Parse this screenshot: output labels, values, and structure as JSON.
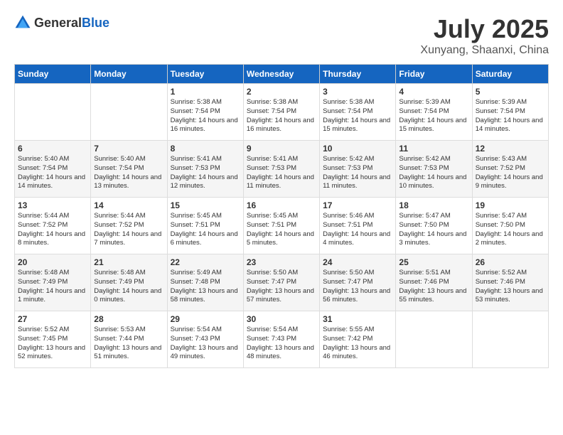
{
  "header": {
    "logo_general": "General",
    "logo_blue": "Blue",
    "month": "July 2025",
    "location": "Xunyang, Shaanxi, China"
  },
  "columns": [
    "Sunday",
    "Monday",
    "Tuesday",
    "Wednesday",
    "Thursday",
    "Friday",
    "Saturday"
  ],
  "weeks": [
    [
      {
        "day": "",
        "info": ""
      },
      {
        "day": "",
        "info": ""
      },
      {
        "day": "1",
        "info": "Sunrise: 5:38 AM\nSunset: 7:54 PM\nDaylight: 14 hours and 16 minutes."
      },
      {
        "day": "2",
        "info": "Sunrise: 5:38 AM\nSunset: 7:54 PM\nDaylight: 14 hours and 16 minutes."
      },
      {
        "day": "3",
        "info": "Sunrise: 5:38 AM\nSunset: 7:54 PM\nDaylight: 14 hours and 15 minutes."
      },
      {
        "day": "4",
        "info": "Sunrise: 5:39 AM\nSunset: 7:54 PM\nDaylight: 14 hours and 15 minutes."
      },
      {
        "day": "5",
        "info": "Sunrise: 5:39 AM\nSunset: 7:54 PM\nDaylight: 14 hours and 14 minutes."
      }
    ],
    [
      {
        "day": "6",
        "info": "Sunrise: 5:40 AM\nSunset: 7:54 PM\nDaylight: 14 hours and 14 minutes."
      },
      {
        "day": "7",
        "info": "Sunrise: 5:40 AM\nSunset: 7:54 PM\nDaylight: 14 hours and 13 minutes."
      },
      {
        "day": "8",
        "info": "Sunrise: 5:41 AM\nSunset: 7:53 PM\nDaylight: 14 hours and 12 minutes."
      },
      {
        "day": "9",
        "info": "Sunrise: 5:41 AM\nSunset: 7:53 PM\nDaylight: 14 hours and 11 minutes."
      },
      {
        "day": "10",
        "info": "Sunrise: 5:42 AM\nSunset: 7:53 PM\nDaylight: 14 hours and 11 minutes."
      },
      {
        "day": "11",
        "info": "Sunrise: 5:42 AM\nSunset: 7:53 PM\nDaylight: 14 hours and 10 minutes."
      },
      {
        "day": "12",
        "info": "Sunrise: 5:43 AM\nSunset: 7:52 PM\nDaylight: 14 hours and 9 minutes."
      }
    ],
    [
      {
        "day": "13",
        "info": "Sunrise: 5:44 AM\nSunset: 7:52 PM\nDaylight: 14 hours and 8 minutes."
      },
      {
        "day": "14",
        "info": "Sunrise: 5:44 AM\nSunset: 7:52 PM\nDaylight: 14 hours and 7 minutes."
      },
      {
        "day": "15",
        "info": "Sunrise: 5:45 AM\nSunset: 7:51 PM\nDaylight: 14 hours and 6 minutes."
      },
      {
        "day": "16",
        "info": "Sunrise: 5:45 AM\nSunset: 7:51 PM\nDaylight: 14 hours and 5 minutes."
      },
      {
        "day": "17",
        "info": "Sunrise: 5:46 AM\nSunset: 7:51 PM\nDaylight: 14 hours and 4 minutes."
      },
      {
        "day": "18",
        "info": "Sunrise: 5:47 AM\nSunset: 7:50 PM\nDaylight: 14 hours and 3 minutes."
      },
      {
        "day": "19",
        "info": "Sunrise: 5:47 AM\nSunset: 7:50 PM\nDaylight: 14 hours and 2 minutes."
      }
    ],
    [
      {
        "day": "20",
        "info": "Sunrise: 5:48 AM\nSunset: 7:49 PM\nDaylight: 14 hours and 1 minute."
      },
      {
        "day": "21",
        "info": "Sunrise: 5:48 AM\nSunset: 7:49 PM\nDaylight: 14 hours and 0 minutes."
      },
      {
        "day": "22",
        "info": "Sunrise: 5:49 AM\nSunset: 7:48 PM\nDaylight: 13 hours and 58 minutes."
      },
      {
        "day": "23",
        "info": "Sunrise: 5:50 AM\nSunset: 7:47 PM\nDaylight: 13 hours and 57 minutes."
      },
      {
        "day": "24",
        "info": "Sunrise: 5:50 AM\nSunset: 7:47 PM\nDaylight: 13 hours and 56 minutes."
      },
      {
        "day": "25",
        "info": "Sunrise: 5:51 AM\nSunset: 7:46 PM\nDaylight: 13 hours and 55 minutes."
      },
      {
        "day": "26",
        "info": "Sunrise: 5:52 AM\nSunset: 7:46 PM\nDaylight: 13 hours and 53 minutes."
      }
    ],
    [
      {
        "day": "27",
        "info": "Sunrise: 5:52 AM\nSunset: 7:45 PM\nDaylight: 13 hours and 52 minutes."
      },
      {
        "day": "28",
        "info": "Sunrise: 5:53 AM\nSunset: 7:44 PM\nDaylight: 13 hours and 51 minutes."
      },
      {
        "day": "29",
        "info": "Sunrise: 5:54 AM\nSunset: 7:43 PM\nDaylight: 13 hours and 49 minutes."
      },
      {
        "day": "30",
        "info": "Sunrise: 5:54 AM\nSunset: 7:43 PM\nDaylight: 13 hours and 48 minutes."
      },
      {
        "day": "31",
        "info": "Sunrise: 5:55 AM\nSunset: 7:42 PM\nDaylight: 13 hours and 46 minutes."
      },
      {
        "day": "",
        "info": ""
      },
      {
        "day": "",
        "info": ""
      }
    ]
  ]
}
